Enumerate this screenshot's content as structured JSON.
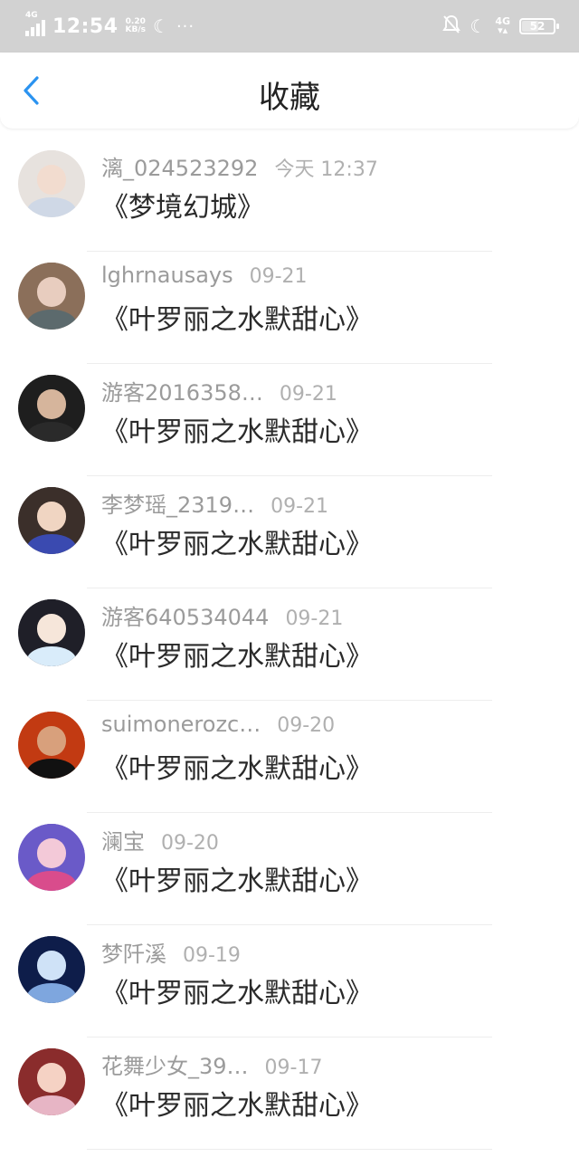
{
  "status_bar": {
    "network_label": "4G",
    "time": "12:54",
    "speed_value": "0.20",
    "speed_unit": "KB/s",
    "signal_2_label": "4G",
    "battery_level": "52",
    "icons": [
      "signal-icon",
      "moon-icon",
      "more-dots-icon",
      "vibrate-off-icon",
      "moon-icon",
      "signal-4g-icon",
      "battery-icon"
    ]
  },
  "header": {
    "title": "收藏",
    "back_icon": "chevron-left-icon",
    "accent_color": "#2b93f0"
  },
  "favorites": [
    {
      "username": "漓_024523292",
      "date": "今天 12:37",
      "book": "《梦境幻城》",
      "avatar_colors": [
        "#e7e2de",
        "#f2dccf",
        "#cfd8e6"
      ]
    },
    {
      "username": "lghrnausays",
      "date": "09-21",
      "book": "《叶罗丽之水默甜心》",
      "avatar_colors": [
        "#8b6f5a",
        "#e8cdbf",
        "#5c6a6d"
      ]
    },
    {
      "username": "游客2016358…",
      "date": "09-21",
      "book": "《叶罗丽之水默甜心》",
      "avatar_colors": [
        "#1e1e1e",
        "#d6b59c",
        "#2a2a2a"
      ]
    },
    {
      "username": "李梦瑶_2319…",
      "date": "09-21",
      "book": "《叶罗丽之水默甜心》",
      "avatar_colors": [
        "#3b2f2a",
        "#f0d5c2",
        "#3a4ab0"
      ]
    },
    {
      "username": "游客640534044",
      "date": "09-21",
      "book": "《叶罗丽之水默甜心》",
      "avatar_colors": [
        "#1f1f28",
        "#f6e6da",
        "#d9ecfa"
      ]
    },
    {
      "username": "suimonerozc…",
      "date": "09-20",
      "book": "《叶罗丽之水默甜心》",
      "avatar_colors": [
        "#c23a12",
        "#d8a07c",
        "#111111"
      ]
    },
    {
      "username": "澜宝",
      "date": "09-20",
      "book": "《叶罗丽之水默甜心》",
      "avatar_colors": [
        "#6a5ac8",
        "#f3c9d8",
        "#d94c8c"
      ]
    },
    {
      "username": "梦阡溪",
      "date": "09-19",
      "book": "《叶罗丽之水默甜心》",
      "avatar_colors": [
        "#0e1d4a",
        "#cfe2f7",
        "#7ea6de"
      ]
    },
    {
      "username": "花舞少女_39…",
      "date": "09-17",
      "book": "《叶罗丽之水默甜心》",
      "avatar_colors": [
        "#8a2c2c",
        "#f5d2c4",
        "#e7b5c5"
      ]
    }
  ]
}
